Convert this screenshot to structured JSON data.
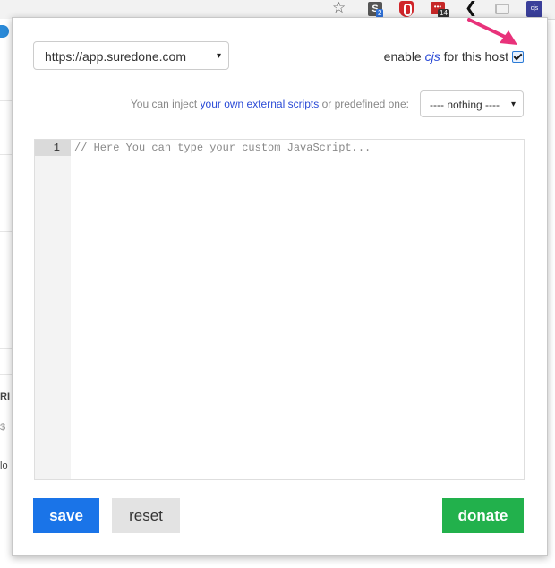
{
  "browser": {
    "star_glyph": "☆",
    "ext_s_label": "S",
    "ext_s_badge": "2",
    "ext_red_label": "•••",
    "ext_red_badge": "14",
    "ext_back_glyph": "❮",
    "ext_cjs_label": "cjs"
  },
  "page_fragments": [
    "RI",
    "$",
    "lo"
  ],
  "popup": {
    "host_select": {
      "value": "https://app.suredone.com",
      "caret": "▾"
    },
    "enable": {
      "prefix": "enable ",
      "cjs": "cjs",
      "suffix": " for this host",
      "checked": true
    },
    "inject": {
      "prefix": "You can inject ",
      "link": "your own external scripts",
      "suffix": " or predefined one:",
      "select_value": "---- nothing ----",
      "caret": "▾"
    },
    "editor": {
      "line_number": "1",
      "placeholder": "// Here You can type your custom JavaScript..."
    },
    "buttons": {
      "save": "save",
      "reset": "reset",
      "donate": "donate"
    }
  },
  "colors": {
    "save": "#1a74e8",
    "donate": "#22b14c",
    "link": "#2b4bd6",
    "annotation_arrow": "#e8327a"
  }
}
